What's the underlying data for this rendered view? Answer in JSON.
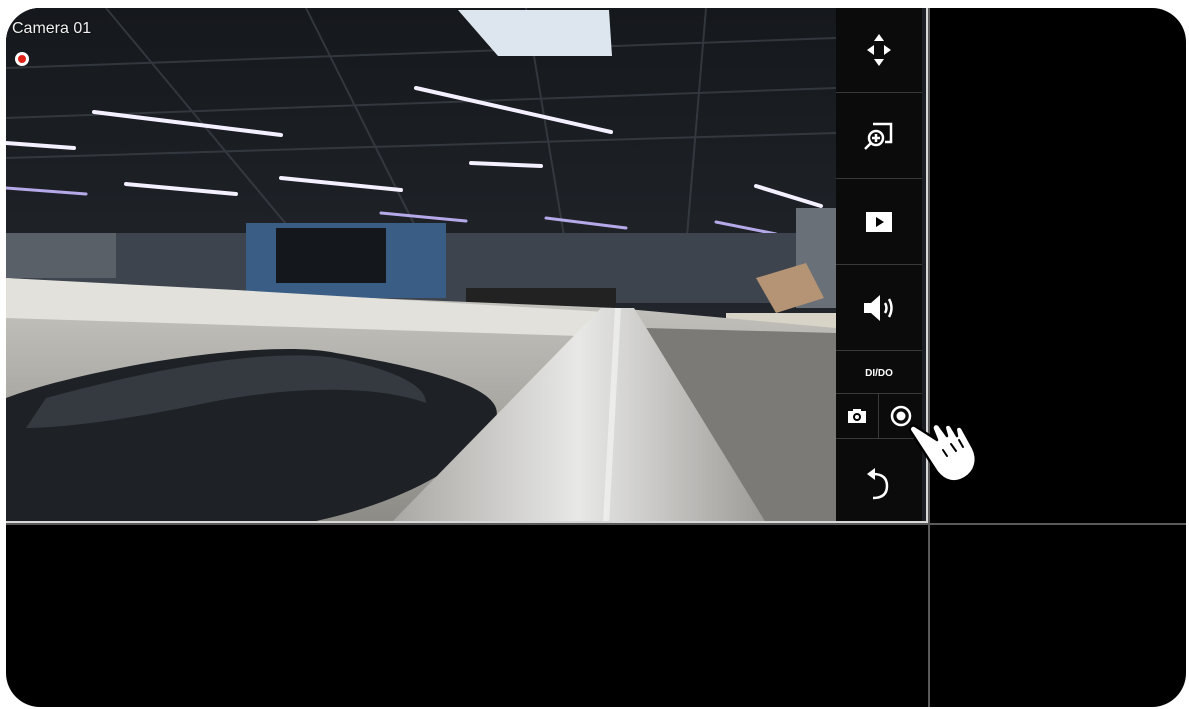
{
  "camera": {
    "name": "Camera 01",
    "recording_indicator": "recording-dot"
  },
  "toolbar": {
    "ptz": "ptz-arrows-icon",
    "zoom": "zoom-in-icon",
    "playback": "play-icon",
    "audio": "speaker-icon",
    "dido_label": "DI/DO",
    "snapshot": "camera-icon",
    "record": "record-icon",
    "back": "undo-icon"
  },
  "colors": {
    "record_red": "#e2231a",
    "toolbar_bg": "#0b0b0b",
    "background": "#000000"
  }
}
